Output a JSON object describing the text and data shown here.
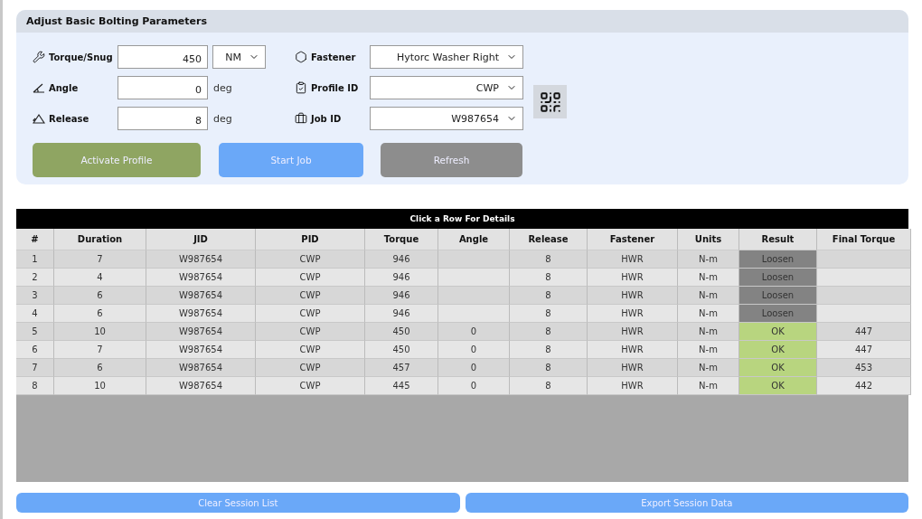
{
  "panel": {
    "title": "Adjust Basic Bolting Parameters",
    "left_fields": [
      {
        "kind": "torque",
        "label": "Torque/Snug",
        "value": "450",
        "unit_select": "NM"
      },
      {
        "kind": "angle",
        "label": "Angle",
        "value": "0",
        "unit": "deg"
      },
      {
        "kind": "release",
        "label": "Release",
        "value": "8",
        "unit": "deg"
      }
    ],
    "right_fields": [
      {
        "kind": "fastener",
        "label": "Fastener",
        "value": "Hytorc Washer Right"
      },
      {
        "kind": "profile",
        "label": "Profile ID",
        "value": "CWP"
      },
      {
        "kind": "job",
        "label": "Job ID",
        "value": "W987654"
      }
    ],
    "buttons": [
      {
        "label": "Activate Profile",
        "kind": "green"
      },
      {
        "label": "Start Job",
        "kind": "blue"
      },
      {
        "label": "Refresh",
        "kind": "gray"
      }
    ]
  },
  "table": {
    "title": "Click a Row For Details",
    "columns": [
      "#",
      "Duration",
      "JID",
      "PID",
      "Torque",
      "Angle",
      "Release",
      "Fastener",
      "Units",
      "Result",
      "Final Torque"
    ],
    "rows": [
      {
        "cells": [
          "1",
          "7",
          "W987654",
          "CWP",
          "946",
          null,
          "8",
          "HWR",
          "N-m",
          "Loosen",
          null
        ],
        "color": "#838383"
      },
      {
        "cells": [
          "2",
          "4",
          "W987654",
          "CWP",
          "946",
          null,
          "8",
          "HWR",
          "N-m",
          "Loosen",
          null
        ],
        "color": "#838383"
      },
      {
        "cells": [
          "3",
          "6",
          "W987654",
          "CWP",
          "946",
          null,
          "8",
          "HWR",
          "N-m",
          "Loosen",
          null
        ],
        "color": "#838383"
      },
      {
        "cells": [
          "4",
          "6",
          "W987654",
          "CWP",
          "946",
          null,
          "8",
          "HWR",
          "N-m",
          "Loosen",
          null
        ],
        "color": "#838383"
      },
      {
        "cells": [
          "5",
          "10",
          "W987654",
          "CWP",
          "450",
          "0",
          "8",
          "HWR",
          "N-m",
          "OK",
          "447"
        ],
        "color": "#b8d57f"
      },
      {
        "cells": [
          "6",
          "7",
          "W987654",
          "CWP",
          "450",
          "0",
          "8",
          "HWR",
          "N-m",
          "OK",
          "447"
        ],
        "color": "#b8d57f"
      },
      {
        "cells": [
          "7",
          "6",
          "W987654",
          "CWP",
          "457",
          "0",
          "8",
          "HWR",
          "N-m",
          "OK",
          "453"
        ],
        "color": "#b8d57f"
      },
      {
        "cells": [
          "8",
          "10",
          "W987654",
          "CWP",
          "445",
          "0",
          "8",
          "HWR",
          "N-m",
          "OK",
          "442"
        ],
        "color": "#b8d57f"
      }
    ]
  },
  "bottom_buttons": [
    "Clear Session List",
    "Export Session Data"
  ]
}
